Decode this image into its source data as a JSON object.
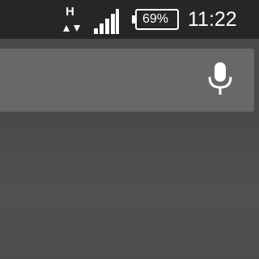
{
  "status_bar": {
    "network_type": "H",
    "battery_level": "69%",
    "time": "11:22",
    "icons": [
      "network-activity-arrows-icon",
      "signal-strength-icon",
      "battery-icon"
    ]
  },
  "search": {
    "value": "",
    "placeholder": "",
    "mic_icon": "microphone-icon"
  },
  "colors": {
    "status_bar_bg": "#262626",
    "search_bar_bg": "#686868",
    "wallpaper": "#4a4a4a",
    "foreground": "#ffffff"
  }
}
